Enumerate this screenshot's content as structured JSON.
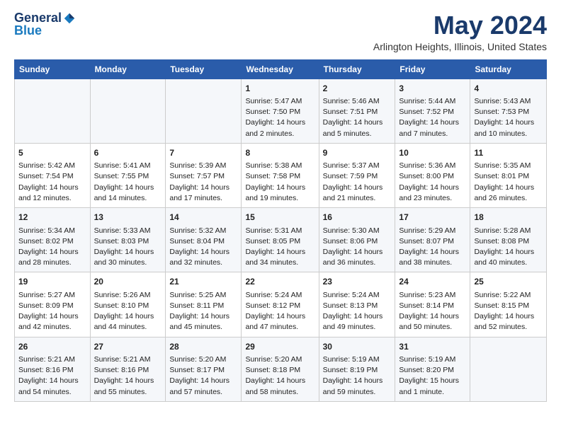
{
  "header": {
    "logo_general": "General",
    "logo_blue": "Blue",
    "month_title": "May 2024",
    "location": "Arlington Heights, Illinois, United States"
  },
  "weekdays": [
    "Sunday",
    "Monday",
    "Tuesday",
    "Wednesday",
    "Thursday",
    "Friday",
    "Saturday"
  ],
  "weeks": [
    [
      {
        "day": "",
        "content": ""
      },
      {
        "day": "",
        "content": ""
      },
      {
        "day": "",
        "content": ""
      },
      {
        "day": "1",
        "content": "Sunrise: 5:47 AM\nSunset: 7:50 PM\nDaylight: 14 hours and 2 minutes."
      },
      {
        "day": "2",
        "content": "Sunrise: 5:46 AM\nSunset: 7:51 PM\nDaylight: 14 hours and 5 minutes."
      },
      {
        "day": "3",
        "content": "Sunrise: 5:44 AM\nSunset: 7:52 PM\nDaylight: 14 hours and 7 minutes."
      },
      {
        "day": "4",
        "content": "Sunrise: 5:43 AM\nSunset: 7:53 PM\nDaylight: 14 hours and 10 minutes."
      }
    ],
    [
      {
        "day": "5",
        "content": "Sunrise: 5:42 AM\nSunset: 7:54 PM\nDaylight: 14 hours and 12 minutes."
      },
      {
        "day": "6",
        "content": "Sunrise: 5:41 AM\nSunset: 7:55 PM\nDaylight: 14 hours and 14 minutes."
      },
      {
        "day": "7",
        "content": "Sunrise: 5:39 AM\nSunset: 7:57 PM\nDaylight: 14 hours and 17 minutes."
      },
      {
        "day": "8",
        "content": "Sunrise: 5:38 AM\nSunset: 7:58 PM\nDaylight: 14 hours and 19 minutes."
      },
      {
        "day": "9",
        "content": "Sunrise: 5:37 AM\nSunset: 7:59 PM\nDaylight: 14 hours and 21 minutes."
      },
      {
        "day": "10",
        "content": "Sunrise: 5:36 AM\nSunset: 8:00 PM\nDaylight: 14 hours and 23 minutes."
      },
      {
        "day": "11",
        "content": "Sunrise: 5:35 AM\nSunset: 8:01 PM\nDaylight: 14 hours and 26 minutes."
      }
    ],
    [
      {
        "day": "12",
        "content": "Sunrise: 5:34 AM\nSunset: 8:02 PM\nDaylight: 14 hours and 28 minutes."
      },
      {
        "day": "13",
        "content": "Sunrise: 5:33 AM\nSunset: 8:03 PM\nDaylight: 14 hours and 30 minutes."
      },
      {
        "day": "14",
        "content": "Sunrise: 5:32 AM\nSunset: 8:04 PM\nDaylight: 14 hours and 32 minutes."
      },
      {
        "day": "15",
        "content": "Sunrise: 5:31 AM\nSunset: 8:05 PM\nDaylight: 14 hours and 34 minutes."
      },
      {
        "day": "16",
        "content": "Sunrise: 5:30 AM\nSunset: 8:06 PM\nDaylight: 14 hours and 36 minutes."
      },
      {
        "day": "17",
        "content": "Sunrise: 5:29 AM\nSunset: 8:07 PM\nDaylight: 14 hours and 38 minutes."
      },
      {
        "day": "18",
        "content": "Sunrise: 5:28 AM\nSunset: 8:08 PM\nDaylight: 14 hours and 40 minutes."
      }
    ],
    [
      {
        "day": "19",
        "content": "Sunrise: 5:27 AM\nSunset: 8:09 PM\nDaylight: 14 hours and 42 minutes."
      },
      {
        "day": "20",
        "content": "Sunrise: 5:26 AM\nSunset: 8:10 PM\nDaylight: 14 hours and 44 minutes."
      },
      {
        "day": "21",
        "content": "Sunrise: 5:25 AM\nSunset: 8:11 PM\nDaylight: 14 hours and 45 minutes."
      },
      {
        "day": "22",
        "content": "Sunrise: 5:24 AM\nSunset: 8:12 PM\nDaylight: 14 hours and 47 minutes."
      },
      {
        "day": "23",
        "content": "Sunrise: 5:24 AM\nSunset: 8:13 PM\nDaylight: 14 hours and 49 minutes."
      },
      {
        "day": "24",
        "content": "Sunrise: 5:23 AM\nSunset: 8:14 PM\nDaylight: 14 hours and 50 minutes."
      },
      {
        "day": "25",
        "content": "Sunrise: 5:22 AM\nSunset: 8:15 PM\nDaylight: 14 hours and 52 minutes."
      }
    ],
    [
      {
        "day": "26",
        "content": "Sunrise: 5:21 AM\nSunset: 8:16 PM\nDaylight: 14 hours and 54 minutes."
      },
      {
        "day": "27",
        "content": "Sunrise: 5:21 AM\nSunset: 8:16 PM\nDaylight: 14 hours and 55 minutes."
      },
      {
        "day": "28",
        "content": "Sunrise: 5:20 AM\nSunset: 8:17 PM\nDaylight: 14 hours and 57 minutes."
      },
      {
        "day": "29",
        "content": "Sunrise: 5:20 AM\nSunset: 8:18 PM\nDaylight: 14 hours and 58 minutes."
      },
      {
        "day": "30",
        "content": "Sunrise: 5:19 AM\nSunset: 8:19 PM\nDaylight: 14 hours and 59 minutes."
      },
      {
        "day": "31",
        "content": "Sunrise: 5:19 AM\nSunset: 8:20 PM\nDaylight: 15 hours and 1 minute."
      },
      {
        "day": "",
        "content": ""
      }
    ]
  ]
}
